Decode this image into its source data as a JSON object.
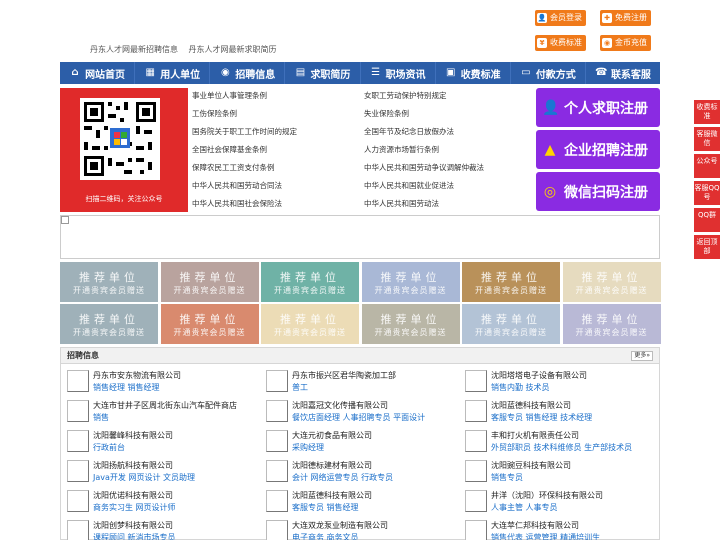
{
  "top_buttons": [
    {
      "label": "会员登录",
      "icon": "user-icon"
    },
    {
      "label": "免费注册",
      "icon": "register-icon"
    },
    {
      "label": "收费标准",
      "icon": "fee-icon"
    },
    {
      "label": "金币充值",
      "icon": "coin-icon"
    }
  ],
  "top_links": [
    "丹东人才网最新招聘信息",
    "丹东人才网最新求职简历"
  ],
  "nav": [
    {
      "label": "网站首页",
      "icon": "home-icon"
    },
    {
      "label": "用人单位",
      "icon": "building-icon"
    },
    {
      "label": "招聘信息",
      "icon": "megaphone-icon"
    },
    {
      "label": "求职简历",
      "icon": "resume-icon"
    },
    {
      "label": "职场资讯",
      "icon": "news-icon"
    },
    {
      "label": "收费标准",
      "icon": "fee-icon"
    },
    {
      "label": "付款方式",
      "icon": "card-icon"
    },
    {
      "label": "联系客服",
      "icon": "phone-icon"
    }
  ],
  "qr_caption": "扫描二维码，关注公众号",
  "laws_left": [
    "事业单位人事管理条例",
    "工伤保险条例",
    "国务院关于职工工作时间的规定",
    "全国社会保障基金条例",
    "保障农民工工资支付条例",
    "中华人民共和国劳动合同法",
    "中华人民共和国社会保险法"
  ],
  "laws_right": [
    "女职工劳动保护特别规定",
    "失业保险条例",
    "全国年节及纪念日放假办法",
    "人力资源市场暂行条例",
    "中华人民共和国劳动争议调解仲裁法",
    "中华人民共和国就业促进法",
    "中华人民共和国劳动法"
  ],
  "register_buttons": [
    {
      "label": "个人求职注册",
      "icon": "person-icon"
    },
    {
      "label": "企业招聘注册",
      "icon": "company-icon"
    },
    {
      "label": "微信扫码注册",
      "icon": "wechat-icon"
    }
  ],
  "promo_tiles": {
    "line1": "推荐单位",
    "line2": "开通贵宾会员赠送",
    "colors": [
      "#9fb1b9",
      "#b9a39e",
      "#6fb2a6",
      "#a9b8d6",
      "#b9915a",
      "#e6dbbf",
      "#9fb1b9",
      "#d98a6e",
      "#ecdcb6",
      "#b9b6a6",
      "#b3c3d6",
      "#b9b9d6"
    ]
  },
  "jobs_title": "招聘信息",
  "jobs_more": "更多»",
  "jobs": [
    {
      "company": "丹东市安东物流有限公司",
      "positions": "销售经理 销售经理"
    },
    {
      "company": "丹东市振兴区君华陶瓷加工部",
      "positions": "普工"
    },
    {
      "company": "沈阳塔塔电子设备有限公司",
      "positions": "销售内勤 技术员"
    },
    {
      "company": "大连市甘井子区周北街东山汽车配件商店",
      "positions": "销售"
    },
    {
      "company": "沈阳嘉冠文化传播有限公司",
      "positions": "餐饮店面经理 人事招聘专员 平面设计"
    },
    {
      "company": "沈阳蓝德科技有限公司",
      "positions": "客服专员 销售经理 技术经理"
    },
    {
      "company": "沈阳馨峰科技有限公司",
      "positions": "行政前台"
    },
    {
      "company": "大连元初食品有限公司",
      "positions": "采购经理"
    },
    {
      "company": "丰和打火机有限责任公司",
      "positions": "外贸部职员 技术科维修员 生产部技术员"
    },
    {
      "company": "沈阳扬航科技有限公司",
      "positions": "Java开发 网页设计 文员助理"
    },
    {
      "company": "沈阳德标建材有限公司",
      "positions": "会计 网络运营专员 行政专员"
    },
    {
      "company": "沈阳豌豆科技有限公司",
      "positions": "销售专员"
    },
    {
      "company": "沈阳优诺科技有限公司",
      "positions": "商务实习生 网页设计师"
    },
    {
      "company": "沈阳蓝德科技有限公司",
      "positions": "客服专员 销售经理"
    },
    {
      "company": "井洋（沈阳）环保科技有限公司",
      "positions": "人事主管 人事专员"
    },
    {
      "company": "沈阳创梦科技有限公司",
      "positions": "课程顾问 新消市场专员"
    },
    {
      "company": "大连双龙泵业制造有限公司",
      "positions": "电子商务 商务文员"
    },
    {
      "company": "大连苹仁邦科技有限公司",
      "positions": "销售代表 运营管理 精通培训生"
    }
  ],
  "side_buttons": [
    "收费标准",
    "客服微信",
    "公众号",
    "客服QQ号",
    "QQ群",
    "返回顶部"
  ]
}
